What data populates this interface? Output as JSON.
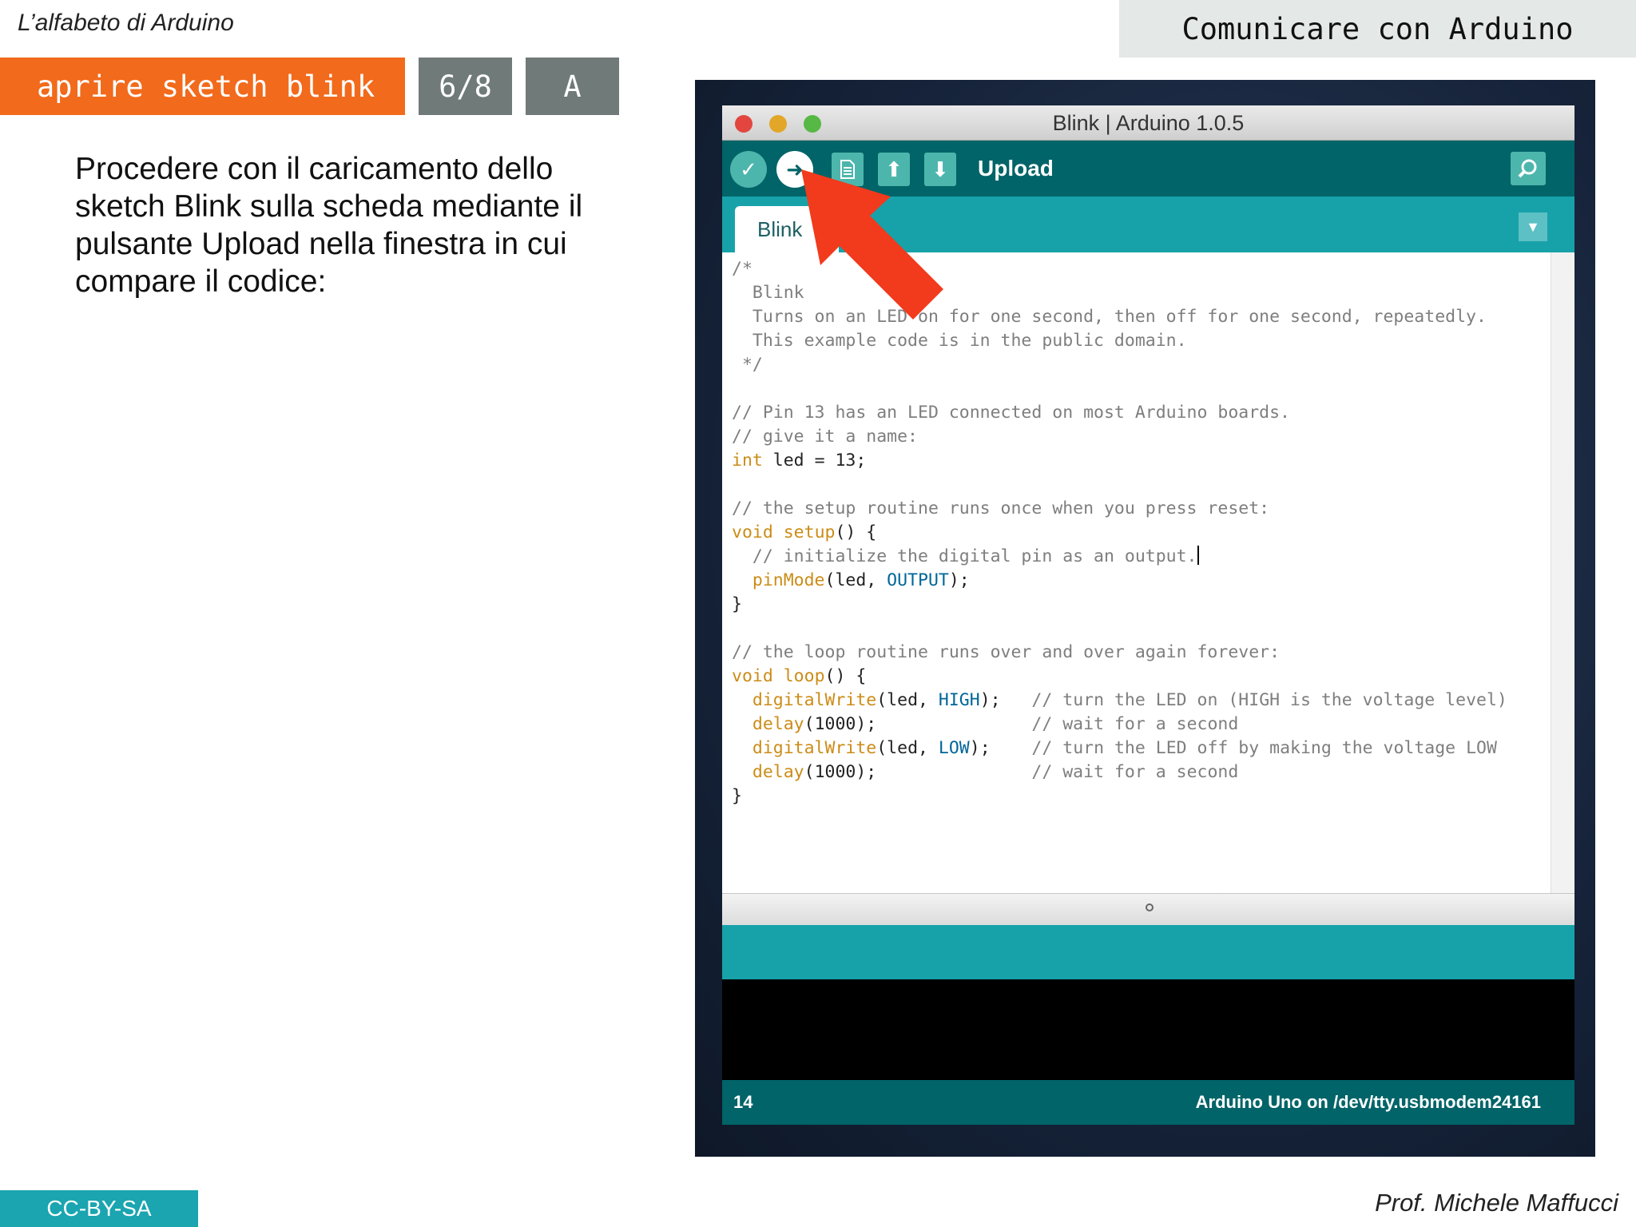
{
  "slide": {
    "course": "L’alfabeto di Arduino",
    "topic": "Comunicare con Arduino",
    "title": "aprire sketch blink",
    "page": "6/8",
    "level": "A",
    "description": "Procedere con il caricamento dello sketch Blink sulla scheda mediante il pulsante Upload nella finestra in cui compare il codice:",
    "license": "CC-BY-SA",
    "author": "Prof. Michele Maffucci"
  },
  "ide": {
    "window_title": "Blink | Arduino 1.0.5",
    "toolbar": {
      "verify_icon": "check-icon",
      "upload_icon": "arrow-right-icon",
      "new_icon": "document-icon",
      "open_icon": "arrow-up-icon",
      "save_icon": "arrow-down-icon",
      "hover_label": "Upload",
      "serial_monitor_icon": "magnifier-icon"
    },
    "tab_label": "Blink",
    "code_lines": [
      "/*",
      "  Blink",
      "  Turns on an LED on for one second, then off for one second, repeatedly.",
      "",
      "  This example code is in the public domain.",
      " */",
      "",
      "// Pin 13 has an LED connected on most Arduino boards.",
      "// give it a name:",
      "int led = 13;",
      "",
      "// the setup routine runs once when you press reset:",
      "void setup() {",
      "  // initialize the digital pin as an output.",
      "  pinMode(led, OUTPUT);",
      "}",
      "",
      "// the loop routine runs over and over again forever:",
      "void loop() {",
      "  digitalWrite(led, HIGH);   // turn the LED on (HIGH is the voltage level)",
      "  delay(1000);               // wait for a second",
      "  digitalWrite(led, LOW);    // turn the LED off by making the voltage LOW",
      "  delay(1000);               // wait for a second",
      "}"
    ],
    "status_line": "14",
    "board": "Arduino Uno on /dev/tty.usbmodem24161"
  },
  "colors": {
    "accent_orange": "#f26a1b",
    "tag_gray": "#6f7a79",
    "teal": "#17a2a9",
    "dark_teal": "#006468",
    "annotation_arrow": "#f23a1c"
  }
}
